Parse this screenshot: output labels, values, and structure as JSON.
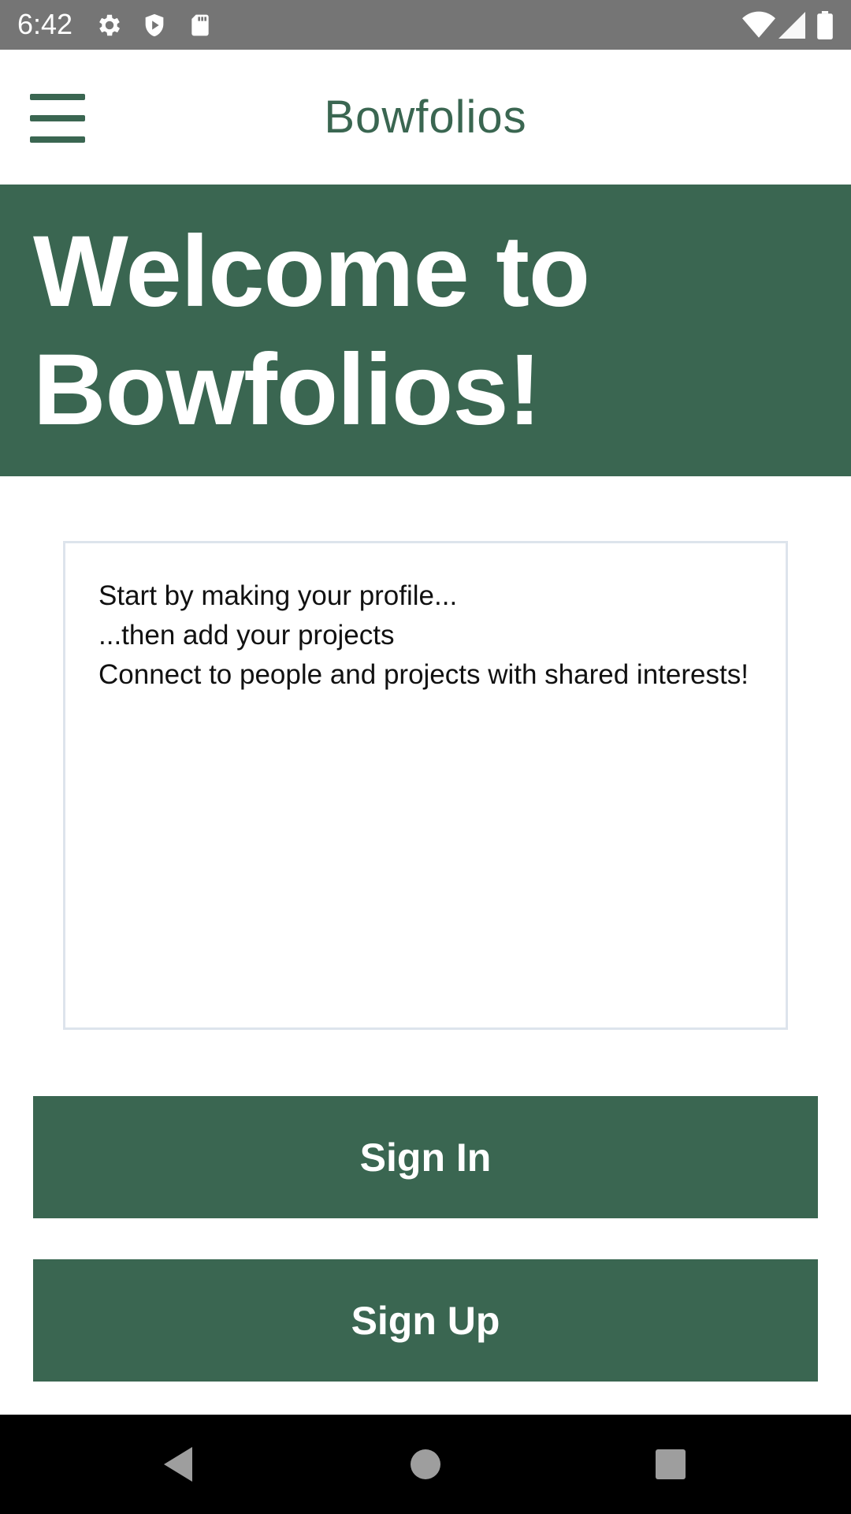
{
  "status_bar": {
    "time": "6:42",
    "left_icons": [
      "gear-icon",
      "shield-icon",
      "sd-card-icon"
    ],
    "right_icons": [
      "wifi-icon",
      "cell-signal-icon",
      "battery-icon"
    ]
  },
  "header": {
    "title": "Bowfolios",
    "menu_icon": "hamburger-menu-icon"
  },
  "hero": {
    "heading": "Welcome to Bowfolios!"
  },
  "intro": {
    "lines": [
      "Start by making your profile...",
      "...then add your projects",
      "Connect to people and projects with shared interests!"
    ]
  },
  "actions": {
    "sign_in_label": "Sign In",
    "sign_up_label": "Sign Up"
  },
  "nav_bar": {
    "icons": [
      "back-icon",
      "home-icon",
      "recents-icon"
    ]
  },
  "colors": {
    "brand_green": "#3a6651",
    "status_bar_gray": "#757575",
    "card_border": "#dde4ec",
    "nav_bar_black": "#000000"
  }
}
